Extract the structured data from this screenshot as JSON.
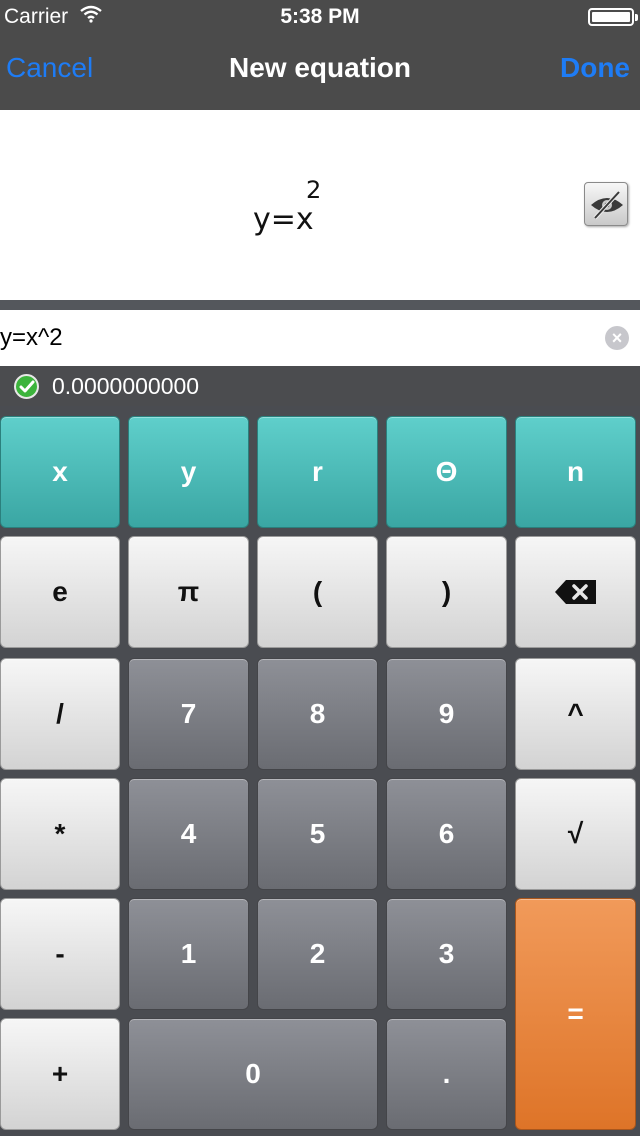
{
  "status_bar": {
    "carrier": "Carrier",
    "time": "5:38 PM"
  },
  "nav": {
    "cancel_label": "Cancel",
    "title": "New equation",
    "done_label": "Done"
  },
  "preview": {
    "formula_base": "y=x",
    "formula_exponent": "2",
    "visibility_icon": "eye-slash-icon"
  },
  "input": {
    "value": "y=x^2",
    "clear_icon": "clear-icon"
  },
  "result": {
    "status_icon": "check-icon",
    "value": "0.0000000000"
  },
  "keypad": {
    "rows": [
      [
        "x",
        "y",
        "r",
        "Θ",
        "n"
      ],
      [
        "e",
        "π",
        "(",
        ")",
        "backspace"
      ],
      [
        "/",
        "7",
        "8",
        "9",
        "^"
      ],
      [
        "*",
        "4",
        "5",
        "6",
        "√"
      ],
      [
        "-",
        "1",
        "2",
        "3",
        "="
      ],
      [
        "+",
        "0",
        "."
      ]
    ]
  },
  "colors": {
    "nav_background": "#4b4b4b",
    "nav_button": "#1e7cf5",
    "variable_keys": "#4ebdb9",
    "digit_keys": "#7c7e84",
    "function_keys": "#e6e6e6",
    "equals_key": "#e8853f",
    "valid_check": "#3cb43c"
  }
}
